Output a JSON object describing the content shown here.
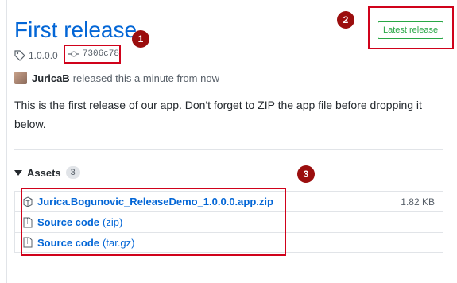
{
  "release": {
    "title": "First release",
    "tag": "1.0.0.0",
    "commit": "7306c78",
    "author": "JuricaB",
    "released_text": "released this a minute from now",
    "description": "This is the first release of our app. Don't forget to ZIP the app file before dropping it below.",
    "badge": "Latest release"
  },
  "assets": {
    "label": "Assets",
    "count": "3",
    "items": [
      {
        "name": "Jurica.Bogunovic_ReleaseDemo_1.0.0.0.app.zip",
        "sub": "",
        "size": "1.82 KB",
        "icon": "package-icon"
      },
      {
        "name": "Source code",
        "sub": "(zip)",
        "size": "",
        "icon": "file-zip-icon"
      },
      {
        "name": "Source code",
        "sub": "(tar.gz)",
        "size": "",
        "icon": "file-zip-icon"
      }
    ]
  },
  "callouts": [
    "1",
    "2",
    "3"
  ],
  "colors": {
    "link": "#0366d6",
    "annotation": "#d0021b",
    "badge": "#28a745"
  }
}
